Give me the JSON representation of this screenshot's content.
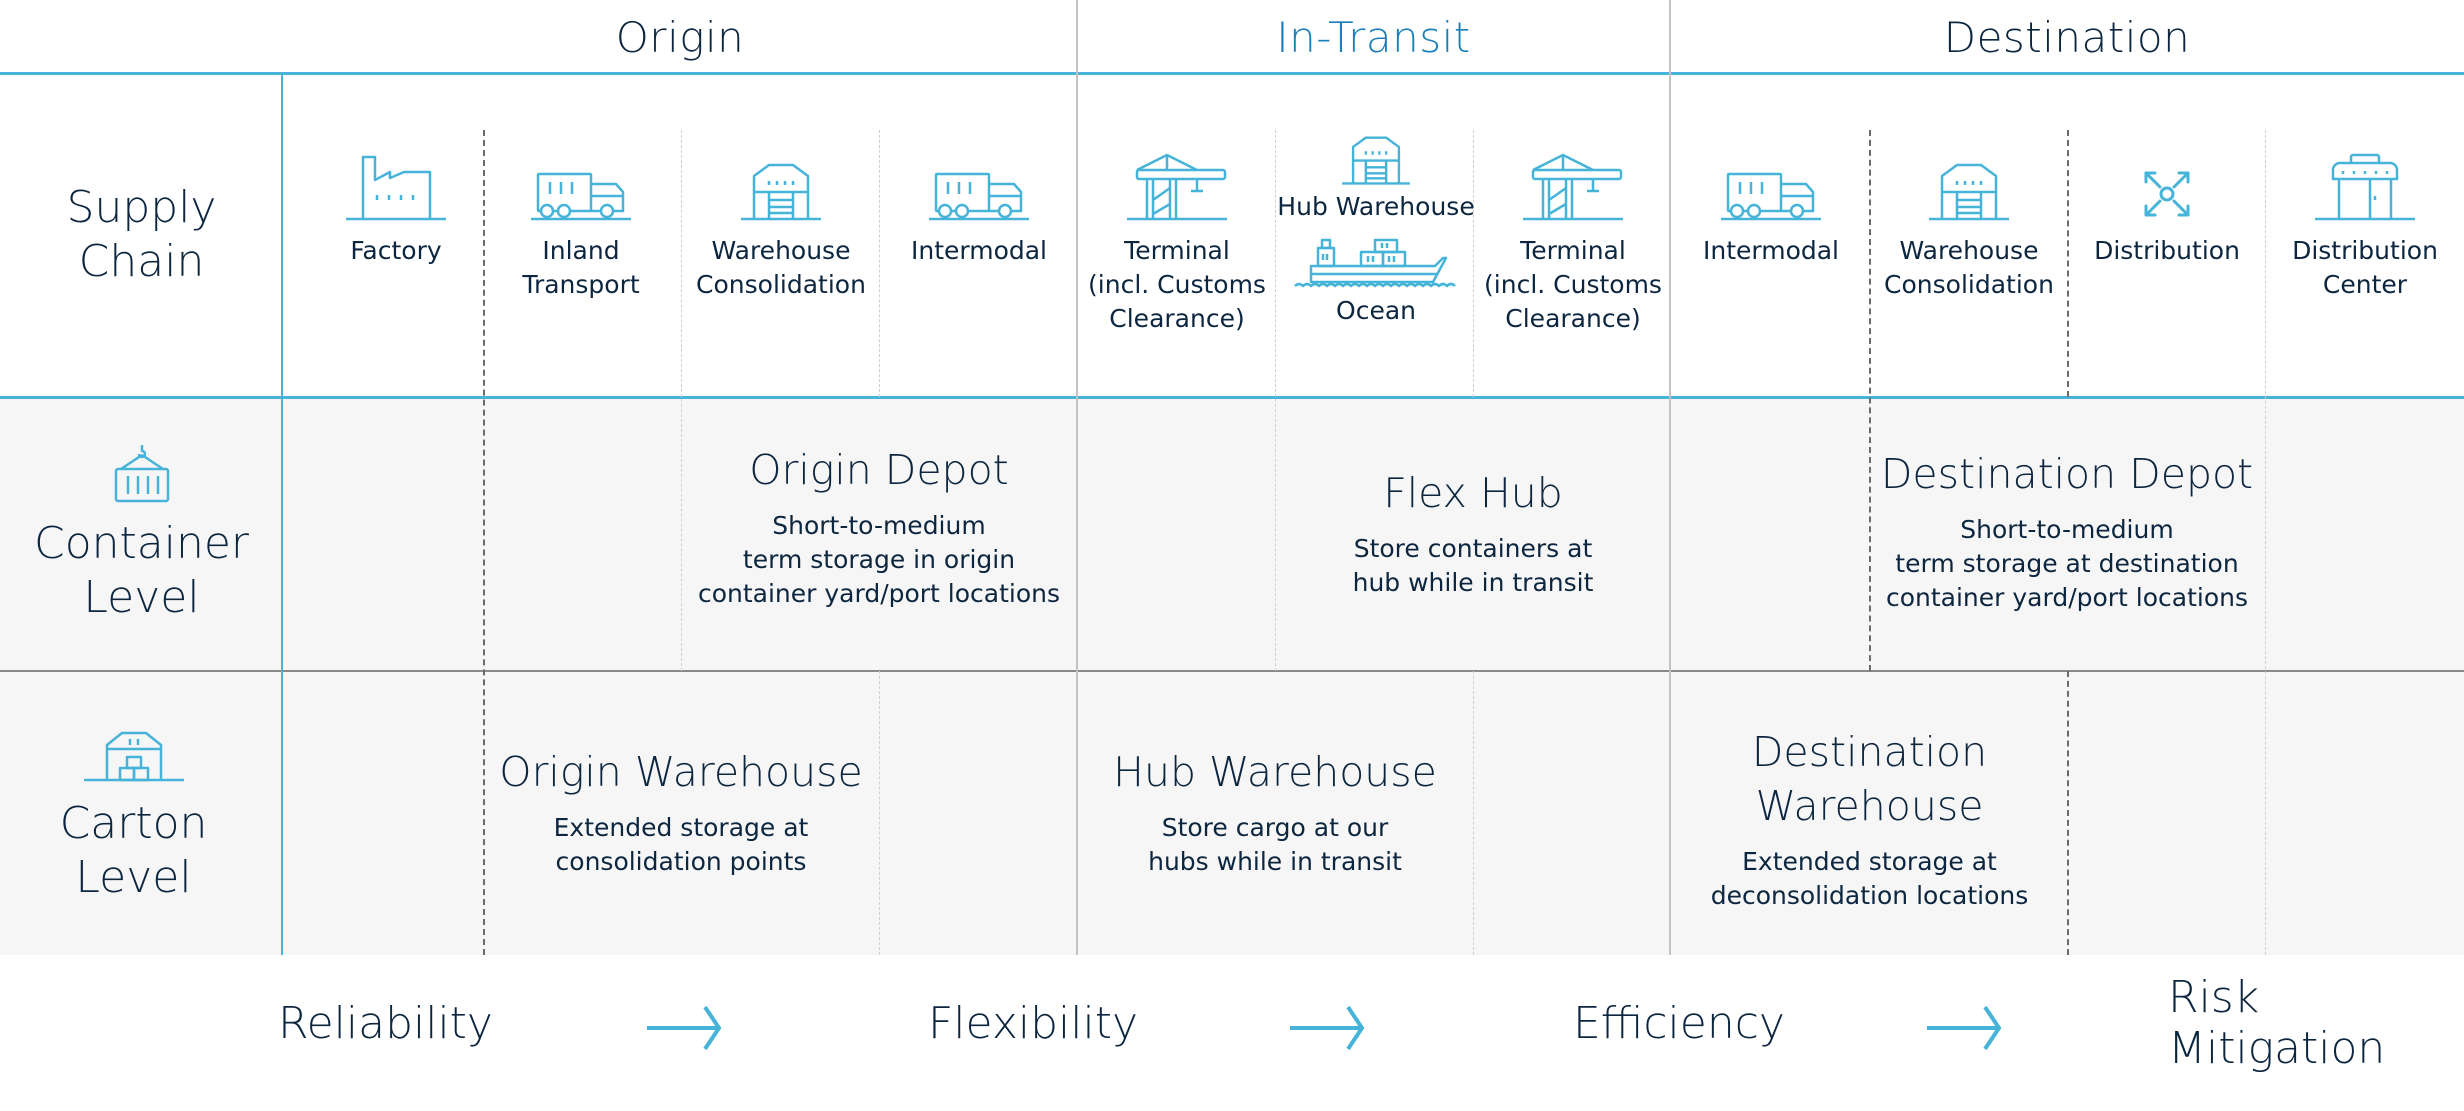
{
  "colors": {
    "accent": "#46b3d8",
    "in_transit_text": "#1a7fb8",
    "text": "#0d2640",
    "row_background": "#f6f6f6",
    "divider_gray": "#c2c2c2"
  },
  "header": {
    "stages": [
      {
        "label": "Origin"
      },
      {
        "label": "In-Transit"
      },
      {
        "label": "Destination"
      }
    ]
  },
  "rows": {
    "supply_chain": {
      "label_line1": "Supply",
      "label_line2": "Chain"
    },
    "container": {
      "label_line1": "Container",
      "label_line2": "Level",
      "icon": "container-icon"
    },
    "carton": {
      "label_line1": "Carton",
      "label_line2": "Level",
      "icon": "carton-warehouse-icon"
    }
  },
  "supply_chain_steps": [
    {
      "icon": "factory-icon",
      "line1": "Factory",
      "line2": "",
      "line3": ""
    },
    {
      "icon": "truck-icon",
      "line1": "Inland",
      "line2": "Transport",
      "line3": ""
    },
    {
      "icon": "warehouse-icon",
      "line1": "Warehouse",
      "line2": "Consolidation",
      "line3": ""
    },
    {
      "icon": "truck-icon",
      "line1": "Intermodal",
      "line2": "",
      "line3": ""
    },
    {
      "icon": "crane-icon",
      "line1": "Terminal",
      "line2": "(incl. Customs",
      "line3": "Clearance)"
    },
    {
      "icon": "warehouse-icon",
      "line1": "Hub Warehouse",
      "line2": "",
      "line3": "",
      "icon2": "ship-icon",
      "line4": "Ocean"
    },
    {
      "icon": "crane-icon",
      "line1": "Terminal",
      "line2": "(incl. Customs",
      "line3": "Clearance)"
    },
    {
      "icon": "truck-icon",
      "line1": "Intermodal",
      "line2": "",
      "line3": ""
    },
    {
      "icon": "warehouse-icon",
      "line1": "Warehouse",
      "line2": "Consolidation",
      "line3": ""
    },
    {
      "icon": "distribution-arrows-icon",
      "line1": "Distribution",
      "line2": "",
      "line3": ""
    },
    {
      "icon": "store-icon",
      "line1": "Distribution",
      "line2": "Center",
      "line3": ""
    }
  ],
  "container_level": [
    {
      "title": "Origin Depot",
      "desc1": "Short-to-medium",
      "desc2": "term storage in origin",
      "desc3": "container yard/port locations"
    },
    {
      "title": "Flex Hub",
      "desc1": "Store containers at",
      "desc2": "hub while in transit",
      "desc3": ""
    },
    {
      "title": "Destination Depot",
      "desc1": "Short-to-medium",
      "desc2": "term storage at destination",
      "desc3": "container yard/port locations"
    }
  ],
  "carton_level": [
    {
      "title": "Origin Warehouse",
      "title2": "",
      "desc1": "Extended storage at",
      "desc2": "consolidation points"
    },
    {
      "title": "Hub Warehouse",
      "title2": "",
      "desc1": "Store cargo at our",
      "desc2": "hubs while in transit"
    },
    {
      "title": "Destination",
      "title2": "Warehouse",
      "desc1": "Extended storage at",
      "desc2": "deconsolidation locations"
    }
  ],
  "benefits": [
    {
      "label": "Reliability"
    },
    {
      "label": "Flexibility"
    },
    {
      "label": "Efficiency"
    },
    {
      "label": "Risk Mitigation"
    }
  ]
}
